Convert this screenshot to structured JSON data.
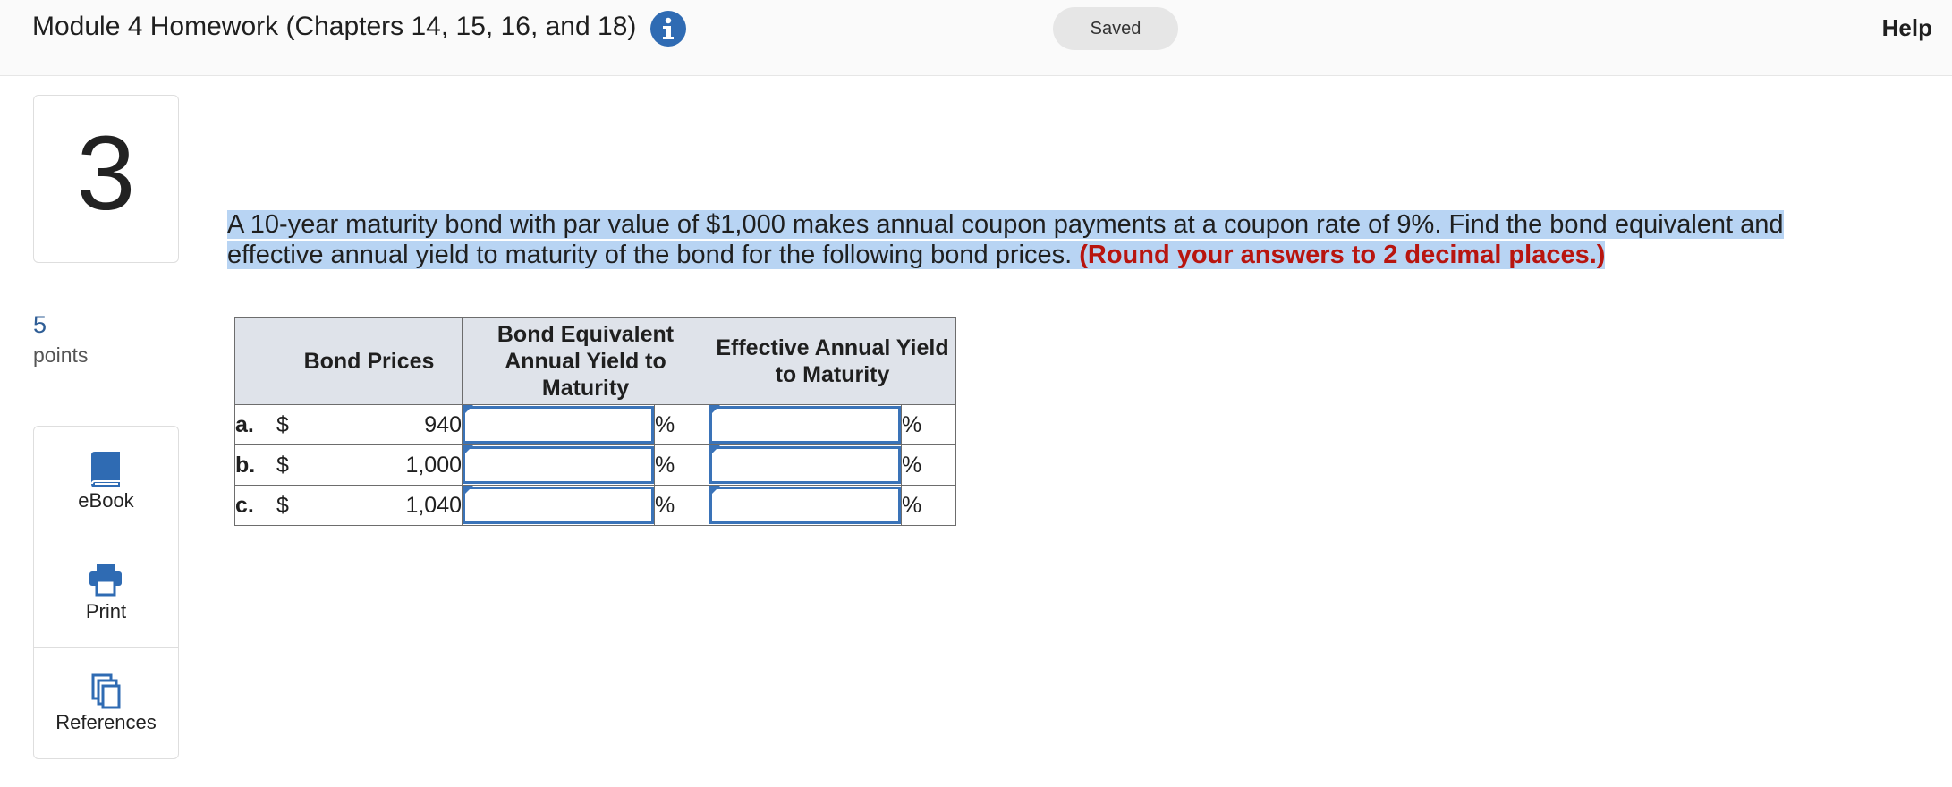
{
  "header": {
    "title": "Module 4 Homework (Chapters 14, 15, 16, and 18)",
    "info_icon": "info-icon",
    "saved_label": "Saved",
    "help_label": "Help"
  },
  "sidebar": {
    "question_number": "3",
    "points_value": "5",
    "points_label": "points",
    "tools": [
      {
        "label": "eBook",
        "icon": "book-icon"
      },
      {
        "label": "Print",
        "icon": "printer-icon"
      },
      {
        "label": "References",
        "icon": "documents-icon"
      }
    ]
  },
  "question": {
    "text": "A 10-year maturity bond with par value of $1,000 makes annual coupon payments at a coupon rate of 9%. Find the bond equivalent and effective annual yield to maturity of the bond for the following bond prices.",
    "instruction": "(Round your answers to 2 decimal places.)"
  },
  "table": {
    "headers": {
      "bond_prices": "Bond Prices",
      "bond_equivalent": "Bond Equivalent Annual Yield to Maturity",
      "effective_annual": "Effective Annual Yield to Maturity"
    },
    "rows": [
      {
        "label": "a.",
        "currency": "$",
        "price": "940",
        "bey": "",
        "eay": "",
        "unit": "%"
      },
      {
        "label": "b.",
        "currency": "$",
        "price": "1,000",
        "bey": "",
        "eay": "",
        "unit": "%"
      },
      {
        "label": "c.",
        "currency": "$",
        "price": "1,040",
        "bey": "",
        "eay": "",
        "unit": "%"
      }
    ]
  },
  "colors": {
    "accent": "#2f6bb3",
    "highlight": "#b8d4f3",
    "instruction_red": "#b8150f",
    "table_header_bg": "#dfe3ea"
  }
}
